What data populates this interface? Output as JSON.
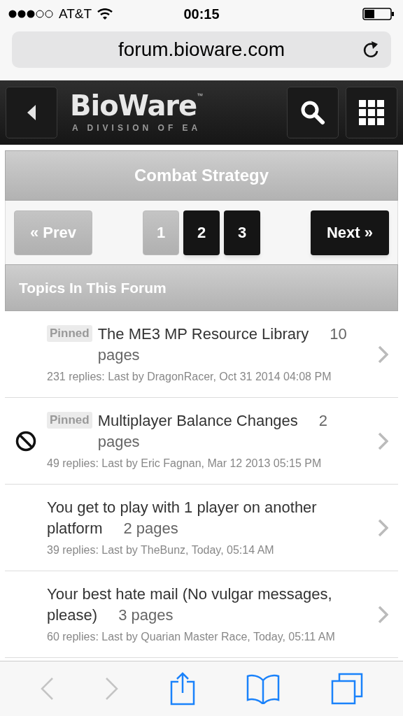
{
  "status_bar": {
    "carrier": "AT&T",
    "time": "00:15"
  },
  "address_bar": {
    "url": "forum.bioware.com"
  },
  "header": {
    "logo": "BioWare",
    "trademark": "™",
    "tagline": "A DIVISION OF EA"
  },
  "forum": {
    "title": "Combat Strategy"
  },
  "pagination": {
    "prev": {
      "label": "« Prev",
      "disabled": true
    },
    "next": {
      "label": "Next »",
      "disabled": false
    },
    "pages": [
      {
        "label": "1",
        "selected": true
      },
      {
        "label": "2",
        "selected": false
      },
      {
        "label": "3",
        "selected": false
      }
    ]
  },
  "topics_header": "Topics In This Forum",
  "topics": [
    {
      "pinned": true,
      "pinned_label": "Pinned",
      "locked": false,
      "title": "The ME3 MP Resource Library",
      "pages": "10 pages",
      "meta": "231 replies: Last by DragonRacer, Oct 31 2014 04:08 PM"
    },
    {
      "pinned": true,
      "pinned_label": "Pinned",
      "locked": true,
      "title": "Multiplayer Balance Changes",
      "pages": "2 pages",
      "meta": "49 replies: Last by Eric Fagnan, Mar 12 2013 05:15 PM"
    },
    {
      "pinned": false,
      "locked": false,
      "title": "You get to play with 1 player on another platform",
      "pages": "2 pages",
      "meta": "39 replies: Last by TheBunz, Today, 05:14 AM"
    },
    {
      "pinned": false,
      "locked": false,
      "title": "Your best hate mail (No vulgar messages, please)",
      "pages": "3 pages",
      "meta": "60 replies: Last by Quarian Master Race, Today, 05:11 AM"
    }
  ]
}
